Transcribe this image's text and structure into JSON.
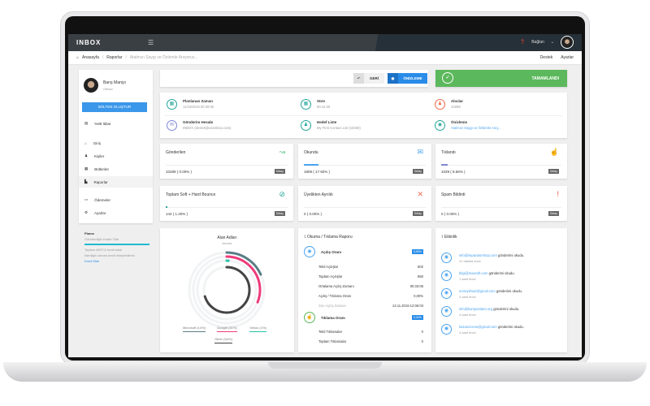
{
  "topbar": {
    "logo": "INBOX",
    "user": "Bağlan",
    "help_icon": "question-icon"
  },
  "breadcrumb": {
    "home": "Anasayfa",
    "reports": "Raporlar",
    "current": "Atalmızı Saygı ve Özlemle Anıyoruz...",
    "support": "Destek",
    "settings": "Ayarlar"
  },
  "sidebar": {
    "name": "Barış Manço",
    "status": "Ofissiz",
    "create_button": "BÜLTEN OLUŞTUR",
    "credit": "%89 İtibar",
    "items": [
      {
        "label": "Giriş"
      },
      {
        "label": "Kişiler"
      },
      {
        "label": "Bültenler"
      },
      {
        "label": "Raporlar"
      },
      {
        "label": "Ödemeler"
      },
      {
        "label": "Ayarlar"
      }
    ],
    "plan": {
      "title": "Planın",
      "name": "Gönderdiğin Kadar Öde",
      "progress_percent": 100,
      "line1": "Toplam 489711 kredi kaldı",
      "line2": "İstediğin zaman kredi ekleyebilirsin",
      "add": "Kredi Ekle"
    }
  },
  "actions": {
    "back": "GERİ",
    "preview": "ÖNİZLEME",
    "status": "TAMAMLANDI"
  },
  "info": [
    {
      "label": "Planlanan Zaman",
      "value": "11/10/2019 00:30:00",
      "color": "#26a69a"
    },
    {
      "label": "Süre",
      "value": "00:12:29",
      "color": "#26a69a"
    },
    {
      "label": "Alıcılar",
      "value": "10289",
      "color": "#f26b50"
    },
    {
      "label": "Gönderim Hesabı",
      "value": "INBOX (destek@useinbox.com)",
      "color": "#7f86d6"
    },
    {
      "label": "Hedef Liste",
      "value": "My First Contact List (10250)",
      "color": "#26a69a"
    },
    {
      "label": "Önizleme",
      "value": "Atalmızı Saygı ve Özlemle Anıy...",
      "color": "#26a69a"
    }
  ],
  "stats": [
    {
      "title": "Gönderilen",
      "value": "10289 ( 0.00% )",
      "percent": 0,
      "color": "#5cc98a",
      "icon": "↝"
    },
    {
      "title": "Okundu",
      "value": "1809 ( 17.92% )",
      "percent": 17.92,
      "color": "#4aa3f0",
      "icon": "✉"
    },
    {
      "title": "Tıklandı",
      "value": "1029 ( 8.56% )",
      "percent": 8.56,
      "color": "#7f86d6",
      "icon": "☝"
    },
    {
      "title": "Toplam Soft + Hard Bounce",
      "value": "144 ( 1.40% )",
      "percent": 1.4,
      "color": "#26a69a",
      "icon": "⊘"
    },
    {
      "title": "Üyelikten Ayrıldı",
      "value": "0 ( 0.00% )",
      "percent": 0,
      "color": "#f26b50",
      "icon": "✕"
    },
    {
      "title": "Spam Bildirdi",
      "value": "0 ( 0.00% )",
      "percent": 0,
      "color": "#e74c3c",
      "icon": "!"
    }
  ],
  "detail_label": "Detay",
  "chart_data": {
    "type": "radial-bar",
    "title": "Alan Adları",
    "subtitle": "Alıcılar",
    "series": [
      {
        "name": "Microsoft (14%)",
        "value": 14,
        "color": "#5a7d86"
      },
      {
        "name": "Google (31%)",
        "value": 31,
        "color": "#ef3a7b"
      },
      {
        "name": "Yahoo (1%)",
        "value": 1,
        "color": "#26c2a8"
      },
      {
        "name": "Other (54%)",
        "value": 54,
        "color": "#444444"
      }
    ]
  },
  "report": {
    "title": "Okuma / Tıklama Raporu",
    "open_label": "Açılış Oranı",
    "open_badge": "5,65%",
    "open_rows": [
      {
        "k": "Tekil Açılışlar",
        "v": "602"
      },
      {
        "k": "Toplam Açılışlar",
        "v": "850"
      },
      {
        "k": "Ortalama Açılış Zamanı",
        "v": "00:33:06"
      },
      {
        "k": "Açılış / Tıklama Oranı",
        "v": "0,00%"
      },
      {
        "k": "Son Açılış Zamanı",
        "v": "13.11.2019 12:06:03"
      }
    ],
    "click_label": "Tıklama Oranı",
    "click_badge": "0,00%",
    "click_rows": [
      {
        "k": "Tekil Tıklamalar",
        "v": "0"
      },
      {
        "k": "Toplam Tıklamalar",
        "v": "0"
      }
    ]
  },
  "activity": {
    "title": "Etkinlik",
    "action": "gönderimi okudu.",
    "items": [
      {
        "email": "info@imparatorshop.com",
        "time": "21 dakika önce"
      },
      {
        "email": "bilgi@maxsoft.com",
        "time": "1 saat önce"
      },
      {
        "email": "emreyilmaz@gmail.com",
        "time": "4 saat önce"
      },
      {
        "email": "info@kumpanitam.org",
        "time": "4 saat önce"
      },
      {
        "email": "kazancicene@gmail.com",
        "time": "4 saat önce"
      }
    ]
  }
}
